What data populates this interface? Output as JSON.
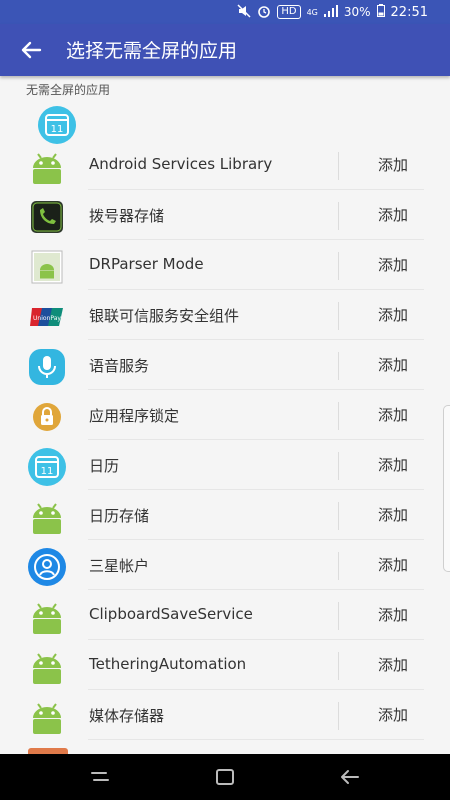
{
  "status": {
    "hd": "HD",
    "net": "4G",
    "battery": "30%",
    "time": "22:51"
  },
  "appbar": {
    "title": "选择无需全屏的应用"
  },
  "section_label": "无需全屏的应用",
  "add_label": "添加",
  "apps": [
    {
      "name": "Android Services Library",
      "icon": "android-icon"
    },
    {
      "name": "拨号器存储",
      "icon": "phone-icon"
    },
    {
      "name": "DRParser Mode",
      "icon": "android-doc-icon"
    },
    {
      "name": "银联可信服务安全组件",
      "icon": "unionpay-icon"
    },
    {
      "name": "语音服务",
      "icon": "microphone-icon"
    },
    {
      "name": "应用程序锁定",
      "icon": "app-lock-icon"
    },
    {
      "name": "日历",
      "icon": "calendar-icon"
    },
    {
      "name": "日历存储",
      "icon": "android-icon"
    },
    {
      "name": "三星帐户",
      "icon": "account-icon"
    },
    {
      "name": "ClipboardSaveService",
      "icon": "android-icon"
    },
    {
      "name": "TetheringAutomation",
      "icon": "android-icon"
    },
    {
      "name": "媒体存储器",
      "icon": "android-icon"
    }
  ],
  "colors": {
    "primary": "#3f51b5",
    "statusbar": "#3b55b6",
    "android": "#8bc34a",
    "calendar": "#3ec1e6"
  }
}
